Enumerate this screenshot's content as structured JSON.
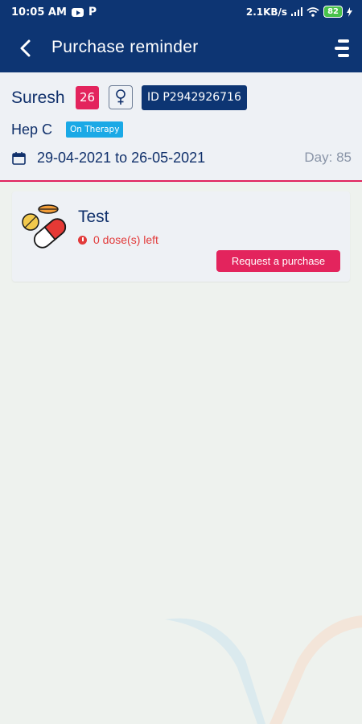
{
  "status_bar": {
    "time": "10:05 AM",
    "speed": "2.1KB/s",
    "battery": "82"
  },
  "header": {
    "title": "Purchase reminder"
  },
  "patient": {
    "name": "Suresh",
    "age": "26",
    "id": "ID P2942926716",
    "condition": "Hep C",
    "status_badge": "On Therapy",
    "date_range": "29-04-2021 to 26-05-2021",
    "day_label": "Day: 85"
  },
  "medications": [
    {
      "name": "Test",
      "doses_left": "0 dose(s) left",
      "action_label": "Request a purchase"
    }
  ],
  "colors": {
    "primary": "#0d3573",
    "accent": "#e3245d",
    "info": "#1aa9e6",
    "warning": "#e23b3b"
  }
}
